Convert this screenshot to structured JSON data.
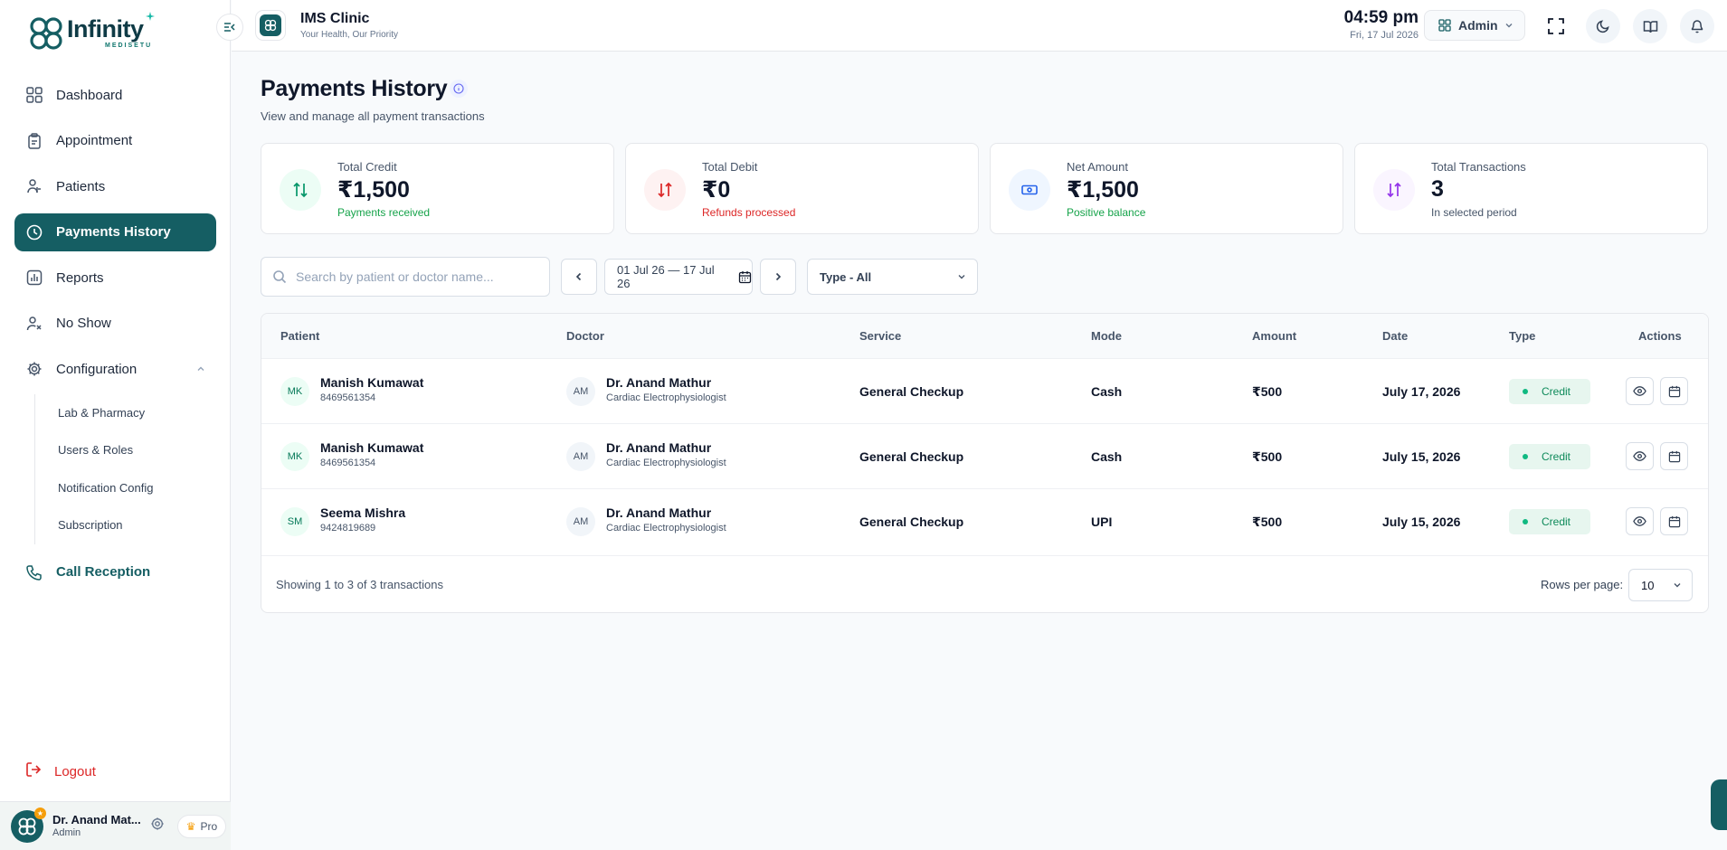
{
  "brand": {
    "name": "Infinity",
    "sub": "MEDISETU"
  },
  "sidebar": {
    "items": [
      {
        "label": "Dashboard",
        "icon": "dashboard-icon"
      },
      {
        "label": "Appointment",
        "icon": "clipboard-icon"
      },
      {
        "label": "Patients",
        "icon": "patients-icon"
      },
      {
        "label": "Payments History",
        "icon": "history-icon",
        "active": true
      },
      {
        "label": "Reports",
        "icon": "reports-icon"
      },
      {
        "label": "No Show",
        "icon": "no-show-icon"
      },
      {
        "label": "Configuration",
        "icon": "gear-icon",
        "expanded": true
      }
    ],
    "config_items": [
      "Lab & Pharmacy",
      "Users & Roles",
      "Notification Config",
      "Subscription"
    ],
    "call_reception": "Call Reception",
    "logout": "Logout",
    "user": {
      "name": "Dr. Anand Mat...",
      "role": "Admin",
      "plan": "Pro"
    }
  },
  "header": {
    "clinic_name": "IMS Clinic",
    "clinic_tagline": "Your Health, Our Priority",
    "time": "04:59 pm",
    "date": "Fri, 17 Jul 2026",
    "role_selector": "Admin"
  },
  "page": {
    "title": "Payments History",
    "subtitle": "View and manage all payment transactions"
  },
  "stats": [
    {
      "label": "Total Credit",
      "value": "₹1,500",
      "note": "Payments received",
      "note_color": "#16a34a",
      "icon_bg": "#ecfdf5",
      "icon_color": "#059669"
    },
    {
      "label": "Total Debit",
      "value": "₹0",
      "note": "Refunds processed",
      "note_color": "#dc2626",
      "icon_bg": "#fef2f2",
      "icon_color": "#dc2626"
    },
    {
      "label": "Net Amount",
      "value": "₹1,500",
      "note": "Positive balance",
      "note_color": "#16a34a",
      "icon_bg": "#eff6ff",
      "icon_color": "#2563eb"
    },
    {
      "label": "Total Transactions",
      "value": "3",
      "note": "In selected period",
      "note_color": "#475569",
      "icon_bg": "#faf5ff",
      "icon_color": "#9333ea"
    }
  ],
  "filters": {
    "search_placeholder": "Search by patient or doctor name...",
    "date_range": "01 Jul 26 — 17 Jul 26",
    "type": "Type - All"
  },
  "table": {
    "columns": [
      "Patient",
      "Doctor",
      "Service",
      "Mode",
      "Amount",
      "Date",
      "Type",
      "Actions"
    ],
    "rows": [
      {
        "initials": "MK",
        "patient": "Manish Kumawat",
        "phone": "8469561354",
        "doc_initials": "AM",
        "doctor": "Dr. Anand Mathur",
        "specialty": "Cardiac Electrophysiologist",
        "service": "General Checkup",
        "mode": "Cash",
        "amount": "₹500",
        "date": "July 17, 2026",
        "type": "Credit"
      },
      {
        "initials": "MK",
        "patient": "Manish Kumawat",
        "phone": "8469561354",
        "doc_initials": "AM",
        "doctor": "Dr. Anand Mathur",
        "specialty": "Cardiac Electrophysiologist",
        "service": "General Checkup",
        "mode": "Cash",
        "amount": "₹500",
        "date": "July 15, 2026",
        "type": "Credit"
      },
      {
        "initials": "SM",
        "patient": "Seema Mishra",
        "phone": "9424819689",
        "doc_initials": "AM",
        "doctor": "Dr. Anand Mathur",
        "specialty": "Cardiac Electrophysiologist",
        "service": "General Checkup",
        "mode": "UPI",
        "amount": "₹500",
        "date": "July 15, 2026",
        "type": "Credit"
      }
    ],
    "footer": "Showing 1 to 3 of 3 transactions",
    "rows_per_page_label": "Rows per page:",
    "rows_per_page": "10"
  },
  "colors": {
    "primary": "#155e63",
    "danger": "#dc2626",
    "success": "#16a34a"
  }
}
